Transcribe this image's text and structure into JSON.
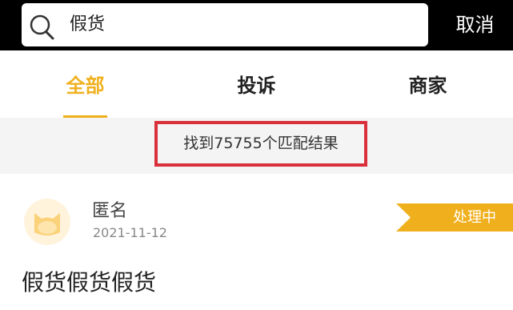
{
  "search": {
    "query": "假货",
    "icon": "search-icon",
    "cancel_label": "取消"
  },
  "tabs": [
    {
      "label": "全部",
      "active": true
    },
    {
      "label": "投诉",
      "active": false
    },
    {
      "label": "商家",
      "active": false
    }
  ],
  "result_summary": "找到75755个匹配结果",
  "post": {
    "author": "匿名",
    "date": "2021-11-12",
    "status": "处理中",
    "title": "假货假货假货",
    "avatar_icon": "cat-avatar-icon"
  },
  "colors": {
    "accent": "#f0b01e",
    "highlight_border": "#d9303b",
    "header_background": "#000000"
  }
}
